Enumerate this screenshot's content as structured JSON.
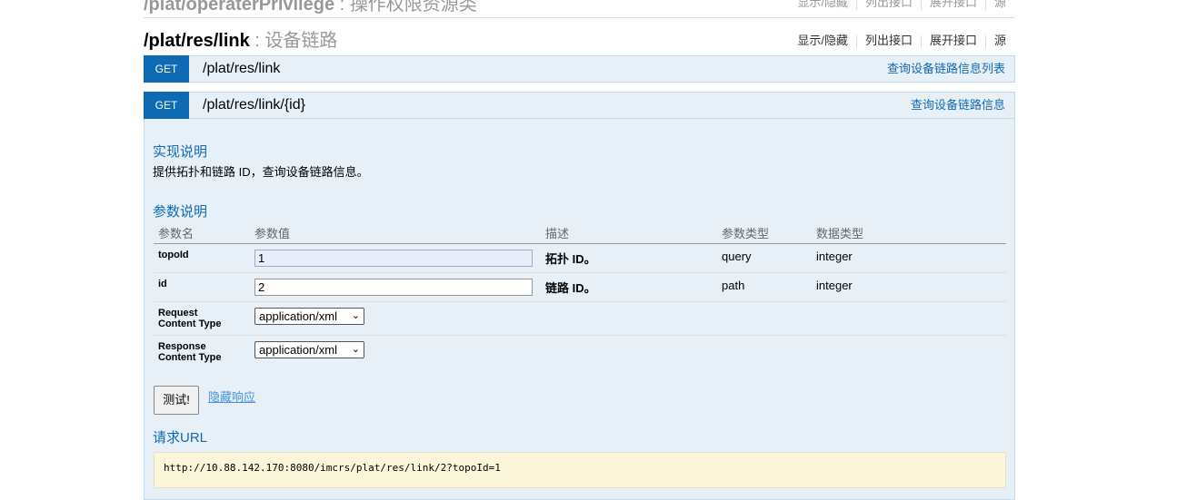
{
  "prev_resource": {
    "path": "/plat/operaterPrivilege",
    "desc": "操作权限资源类",
    "ops": [
      "显示/隐藏",
      "列出接口",
      "展开接口",
      "源"
    ]
  },
  "resource": {
    "path": "/plat/res/link",
    "desc": "设备链路",
    "ops": [
      "显示/隐藏",
      "列出接口",
      "展开接口",
      "源"
    ]
  },
  "endpoints": [
    {
      "method": "GET",
      "path": "/plat/res/link",
      "summary": "查询设备链路信息列表"
    },
    {
      "method": "GET",
      "path": "/plat/res/link/{id}",
      "summary": "查询设备链路信息"
    }
  ],
  "impl": {
    "title": "实现说明",
    "text": "提供拓扑和链路 ID，查询设备链路信息。"
  },
  "params": {
    "title": "参数说明",
    "headers": [
      "参数名",
      "参数值",
      "描述",
      "参数类型",
      "数据类型"
    ],
    "rows": [
      {
        "name": "topoId",
        "value": "1",
        "desc": "拓扑 ID。",
        "param_type": "query",
        "data_type": "integer"
      },
      {
        "name": "id",
        "value": "2",
        "desc": "链路 ID。",
        "param_type": "path",
        "data_type": "integer"
      }
    ],
    "request_ct_label_1": "Request",
    "request_ct_label_2": "Content Type",
    "request_ct_value": "application/xml",
    "response_ct_label_1": "Response",
    "response_ct_label_2": "Content Type",
    "response_ct_value": "application/xml"
  },
  "actions": {
    "try_label": "测试!",
    "hide_label": "隐藏响应"
  },
  "request_url": {
    "title": "请求URL",
    "url": "http://10.88.142.170:8080/imcrs/plat/res/link/2?topoId=1"
  }
}
